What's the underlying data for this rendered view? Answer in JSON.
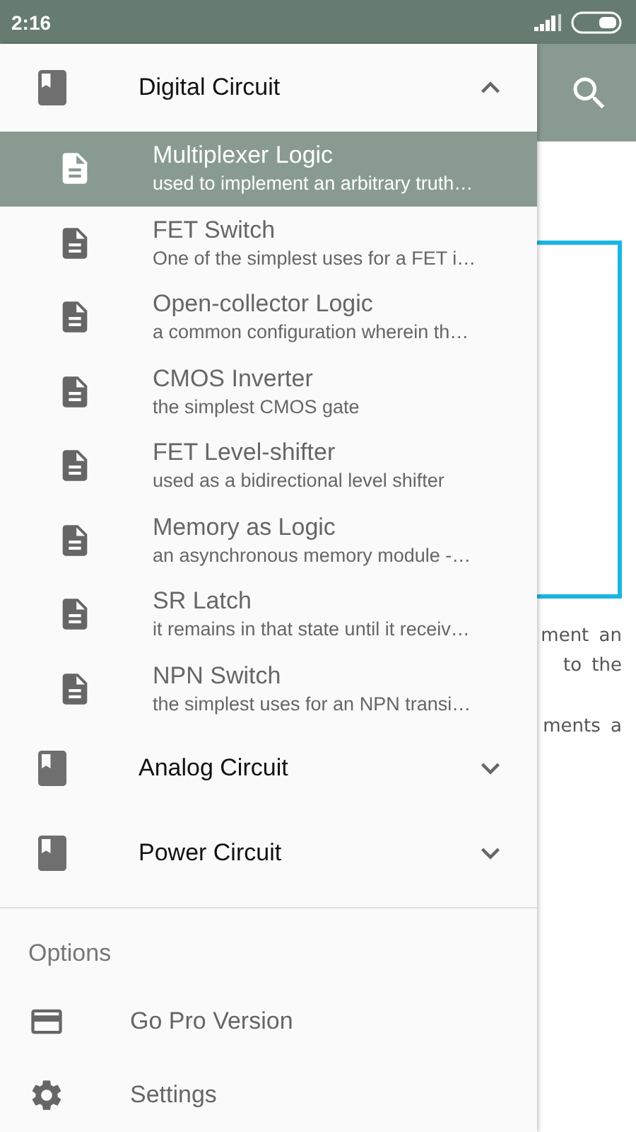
{
  "status_bar": {
    "time": "2:16"
  },
  "content": {
    "paragraphs": [
      [
        "ment an",
        "to the"
      ],
      [
        "ments a"
      ]
    ]
  },
  "drawer": {
    "groups": [
      {
        "title": "Digital Circuit",
        "expanded": true,
        "items": [
          {
            "title": "Multiplexer Logic",
            "subtitle": "used to implement an arbitrary truth…",
            "selected": true
          },
          {
            "title": "FET Switch",
            "subtitle": "One of the simplest uses for a FET i…",
            "selected": false
          },
          {
            "title": "Open-collector Logic",
            "subtitle": "a common configuration wherein th…",
            "selected": false
          },
          {
            "title": "CMOS Inverter",
            "subtitle": "the simplest CMOS gate",
            "selected": false
          },
          {
            "title": "FET Level-shifter",
            "subtitle": "used as a bidirectional level shifter",
            "selected": false
          },
          {
            "title": "Memory as Logic",
            "subtitle": "an asynchronous memory module -…",
            "selected": false
          },
          {
            "title": "SR Latch",
            "subtitle": "it remains in that state until it receiv…",
            "selected": false
          },
          {
            "title": "NPN Switch",
            "subtitle": "the simplest uses for an NPN transi…",
            "selected": false
          }
        ]
      },
      {
        "title": "Analog Circuit",
        "expanded": false
      },
      {
        "title": "Power Circuit",
        "expanded": false
      }
    ],
    "options": {
      "heading": "Options",
      "items": [
        {
          "kind": "pro",
          "label": "Go Pro Version"
        },
        {
          "kind": "settings",
          "label": "Settings"
        }
      ]
    }
  }
}
